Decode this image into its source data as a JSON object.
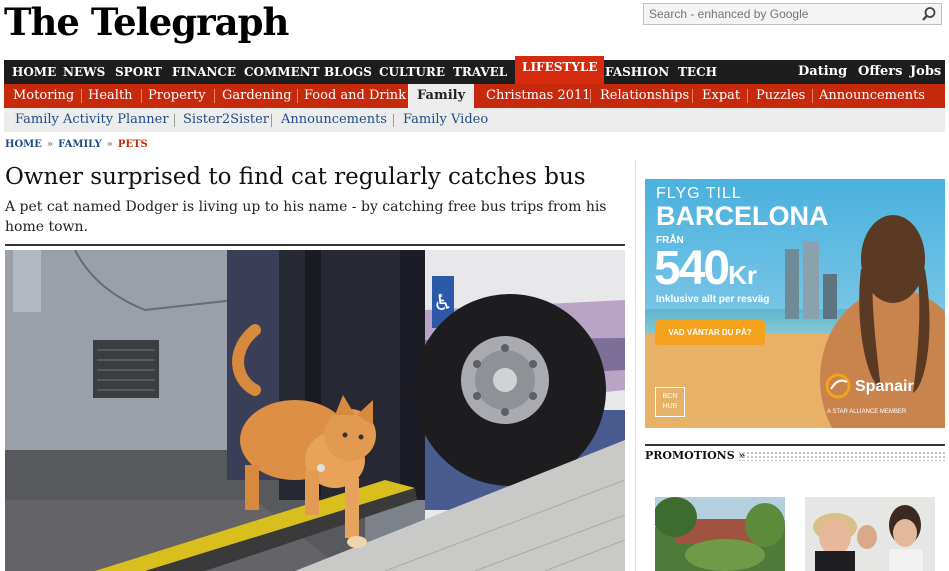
{
  "masthead": {
    "title": "The Telegraph"
  },
  "search": {
    "placeholder": "Search - enhanced by Google"
  },
  "main_nav": {
    "items": [
      "HOME",
      "NEWS",
      "SPORT",
      "FINANCE",
      "COMMENT",
      "BLOGS",
      "CULTURE",
      "TRAVEL",
      "LIFESTYLE",
      "FASHION",
      "TECH"
    ],
    "active": "LIFESTYLE",
    "right_items": [
      "Dating",
      "Offers",
      "Jobs"
    ]
  },
  "section_nav": {
    "items": [
      "Motoring",
      "Health",
      "Property",
      "Gardening",
      "Food and Drink",
      "Family",
      "Christmas 2011",
      "Relationships",
      "Expat",
      "Puzzles",
      "Announcements"
    ],
    "active": "Family"
  },
  "sub_nav": {
    "items": [
      "Family Activity Planner",
      "Sister2Sister",
      "Announcements",
      "Family Video"
    ]
  },
  "breadcrumb": {
    "items": [
      "HOME",
      "FAMILY",
      "PETS"
    ],
    "separator": "»"
  },
  "article": {
    "headline": "Owner surprised to find cat regularly catches bus",
    "standfirst": "A pet cat named Dodger is living up to his name - by catching free bus trips from his home town."
  },
  "ad": {
    "line1": "FLYG TILL",
    "line2": "BARCELONA",
    "line3": "FRÅN",
    "price": "540",
    "currency": "Kr",
    "note": "Inklusive allt per resväg",
    "cta": "VAD VÄNTAR DU PÅ?",
    "hub": "BCN HUB",
    "brand": "Spanair",
    "member": "A STAR ALLIANCE MEMBER"
  },
  "promotions": {
    "title": "PROMOTIONS »"
  },
  "colors": {
    "nav_dark": "#1d1d1d",
    "section_red": "#c7290c",
    "active_red": "#d62b0e",
    "link_blue": "#1f4c86",
    "ad_blue": "#4fb3dd"
  }
}
